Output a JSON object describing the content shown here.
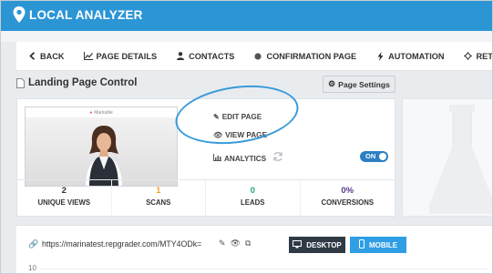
{
  "app": {
    "title": "LOCAL ANALYZER",
    "logo_icon": "map-pin-icon",
    "brand_color": "#2c96d5"
  },
  "nav": {
    "items": [
      {
        "label": "BACK",
        "icon": "chevron-left-icon"
      },
      {
        "label": "PAGE DETAILS",
        "icon": "line-chart-icon"
      },
      {
        "label": "CONTACTS",
        "icon": "user-icon"
      },
      {
        "label": "CONFIRMATION PAGE",
        "icon": "circle-icon"
      },
      {
        "label": "AUTOMATION",
        "icon": "bolt-icon"
      },
      {
        "label": "RETARGETING",
        "icon": "crosshair-icon"
      }
    ]
  },
  "section": {
    "title": "Landing Page Control",
    "settings_label": "Page Settings"
  },
  "preview": {
    "brand": "Markuble"
  },
  "actions": {
    "edit": "EDIT PAGE",
    "view": "VIEW PAGE",
    "analytics": "ANALYTICS",
    "toggle": "ON"
  },
  "stats": [
    {
      "value": "2",
      "label": "UNIQUE VIEWS",
      "color": "#333333"
    },
    {
      "value": "1",
      "label": "SCANS",
      "color": "#f0a030"
    },
    {
      "value": "0",
      "label": "LEADS",
      "color": "#2aa876"
    },
    {
      "value": "0%",
      "label": "CONVERSIONS",
      "color": "#5a3a8a"
    }
  ],
  "url": {
    "text": "https://marinatest.repgrader.com/MTY4ODk=",
    "desktop_label": "DESKTOP",
    "mobile_label": "MOBILE"
  },
  "chart": {
    "y_tick": "10"
  },
  "colors": {
    "accent": "#2c96d5",
    "desktop_btn": "#2f3a45",
    "mobile_btn": "#2f9ee4",
    "toggle": "#2c7fc4"
  }
}
